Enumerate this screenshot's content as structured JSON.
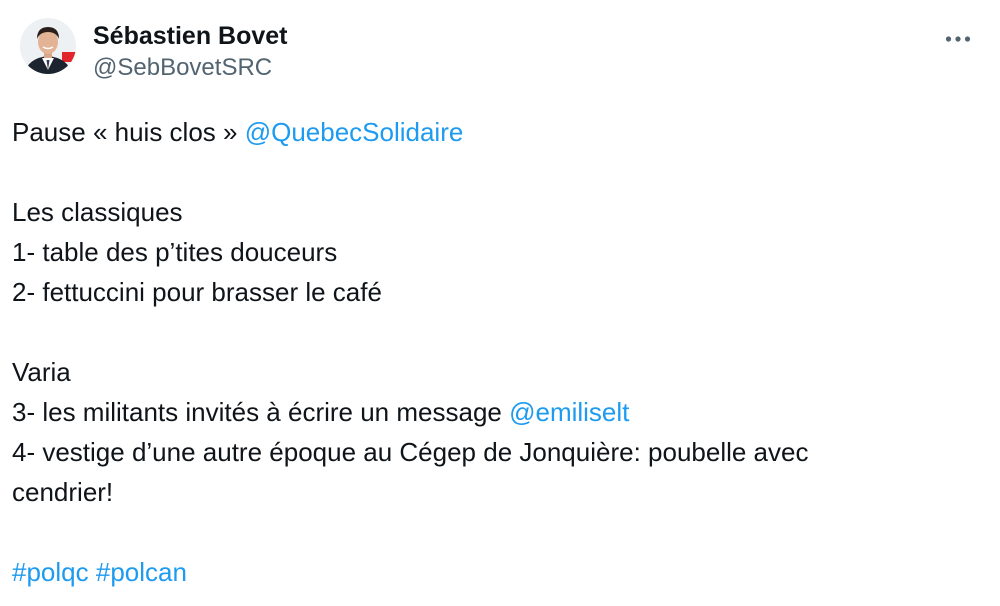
{
  "author": {
    "display_name": "Sébastien Bovet",
    "handle": "@SebBovetSRC"
  },
  "more_menu": {
    "icon": "more-horizontal-icon"
  },
  "tweet": {
    "line1_text": "Pause « huis clos » ",
    "line1_mention": "@QuebecSolidaire",
    "line2": "Les classiques",
    "line3": "1- table des p’tites douceurs",
    "line4": "2- fettuccini pour brasser le café",
    "line5": "Varia",
    "line6_text": "3- les militants invités à écrire un message ",
    "line6_mention": "@emiliselt",
    "line7": "4- vestige d’une autre époque au Cégep de Jonquière: poubelle avec",
    "line8": "cendrier!",
    "hashtag1": "#polqc",
    "hashtag2": "#polcan"
  },
  "colors": {
    "link": "#1d9bf0",
    "text": "#0f1419",
    "secondary": "#536471"
  }
}
